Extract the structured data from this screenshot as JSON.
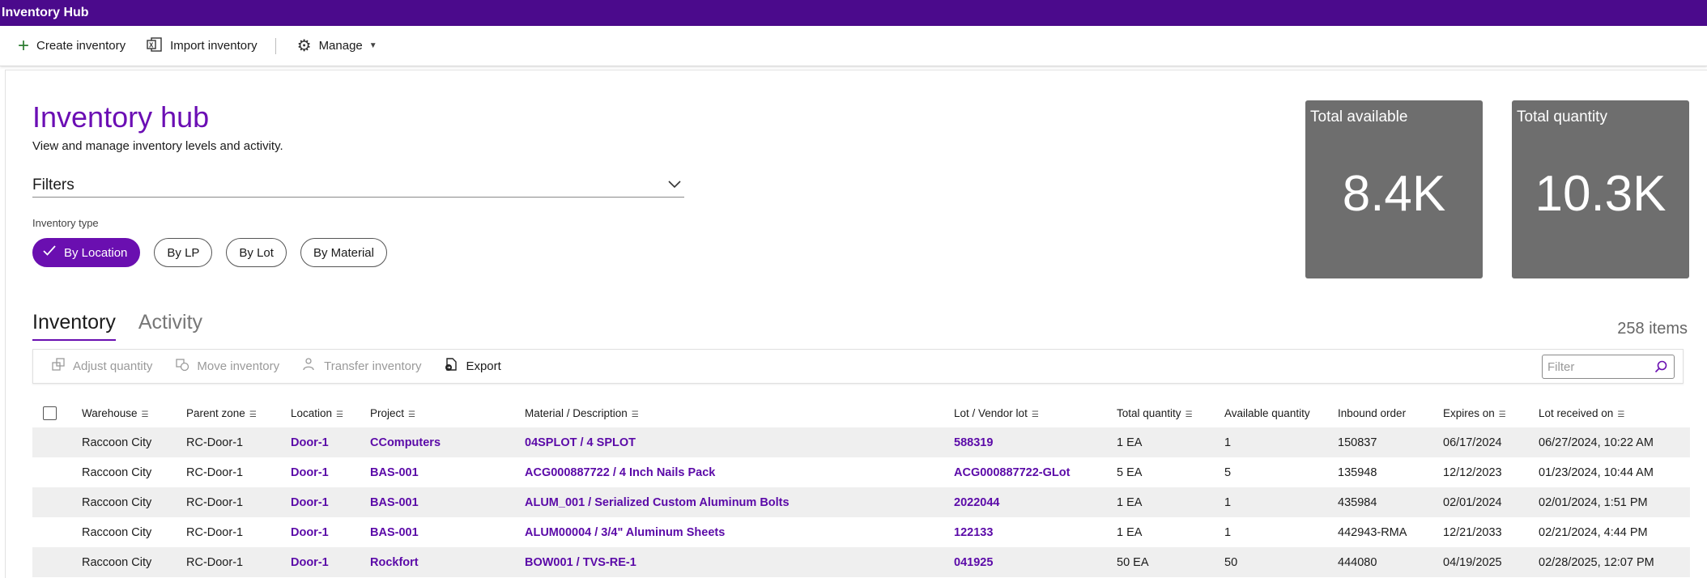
{
  "app": {
    "title": "Inventory Hub"
  },
  "commandbar": {
    "create_label": "Create inventory",
    "import_label": "Import inventory",
    "manage_label": "Manage"
  },
  "header": {
    "title": "Inventory hub",
    "subtitle": "View and manage inventory levels and activity.",
    "filters_label": "Filters",
    "inventory_type_label": "Inventory type",
    "pills": [
      {
        "label": "By Location",
        "selected": true
      },
      {
        "label": "By LP",
        "selected": false
      },
      {
        "label": "By Lot",
        "selected": false
      },
      {
        "label": "By Material",
        "selected": false
      }
    ]
  },
  "cards": {
    "available": {
      "label": "Total available",
      "value": "8.4K"
    },
    "quantity": {
      "label": "Total quantity",
      "value": "10.3K"
    }
  },
  "tabs": [
    {
      "label": "Inventory",
      "active": true
    },
    {
      "label": "Activity",
      "active": false
    }
  ],
  "item_count": "258 items",
  "grid_actions": {
    "adjust": "Adjust quantity",
    "move": "Move inventory",
    "transfer": "Transfer inventory",
    "export": "Export",
    "filter_placeholder": "Filter"
  },
  "table": {
    "columns": [
      "Warehouse",
      "Parent zone",
      "Location",
      "Project",
      "Material / Description",
      "Lot / Vendor lot",
      "Total quantity",
      "Available quantity",
      "Inbound order",
      "Expires on",
      "Lot received on"
    ],
    "rows": [
      [
        "Raccoon City",
        "RC-Door-1",
        "Door-1",
        "CComputers",
        "04SPLOT / 4 SPLOT",
        "588319",
        "1 EA",
        "1",
        "150837",
        "06/17/2024",
        "06/27/2024, 10:22 AM"
      ],
      [
        "Raccoon City",
        "RC-Door-1",
        "Door-1",
        "BAS-001",
        "ACG000887722 / 4 Inch Nails Pack",
        "ACG000887722-GLot",
        "5 EA",
        "5",
        "135948",
        "12/12/2023",
        "01/23/2024, 10:44 AM"
      ],
      [
        "Raccoon City",
        "RC-Door-1",
        "Door-1",
        "BAS-001",
        "ALUM_001 / Serialized Custom Aluminum Bolts",
        "2022044",
        "1 EA",
        "1",
        "435984",
        "02/01/2024",
        "02/01/2024, 1:51 PM"
      ],
      [
        "Raccoon City",
        "RC-Door-1",
        "Door-1",
        "BAS-001",
        "ALUM00004 / 3/4\" Aluminum Sheets",
        "122133",
        "1 EA",
        "1",
        "442943-RMA",
        "12/21/2033",
        "02/21/2024, 4:44 PM"
      ],
      [
        "Raccoon City",
        "RC-Door-1",
        "Door-1",
        "Rockfort",
        "BOW001 / TVS-RE-1",
        "041925",
        "50 EA",
        "50",
        "444080",
        "04/19/2025",
        "02/28/2025, 12:07 PM"
      ]
    ]
  },
  "colors": {
    "brand": "#4b0a8c",
    "accent": "#6a0fb0",
    "card": "#6e6e6e"
  }
}
